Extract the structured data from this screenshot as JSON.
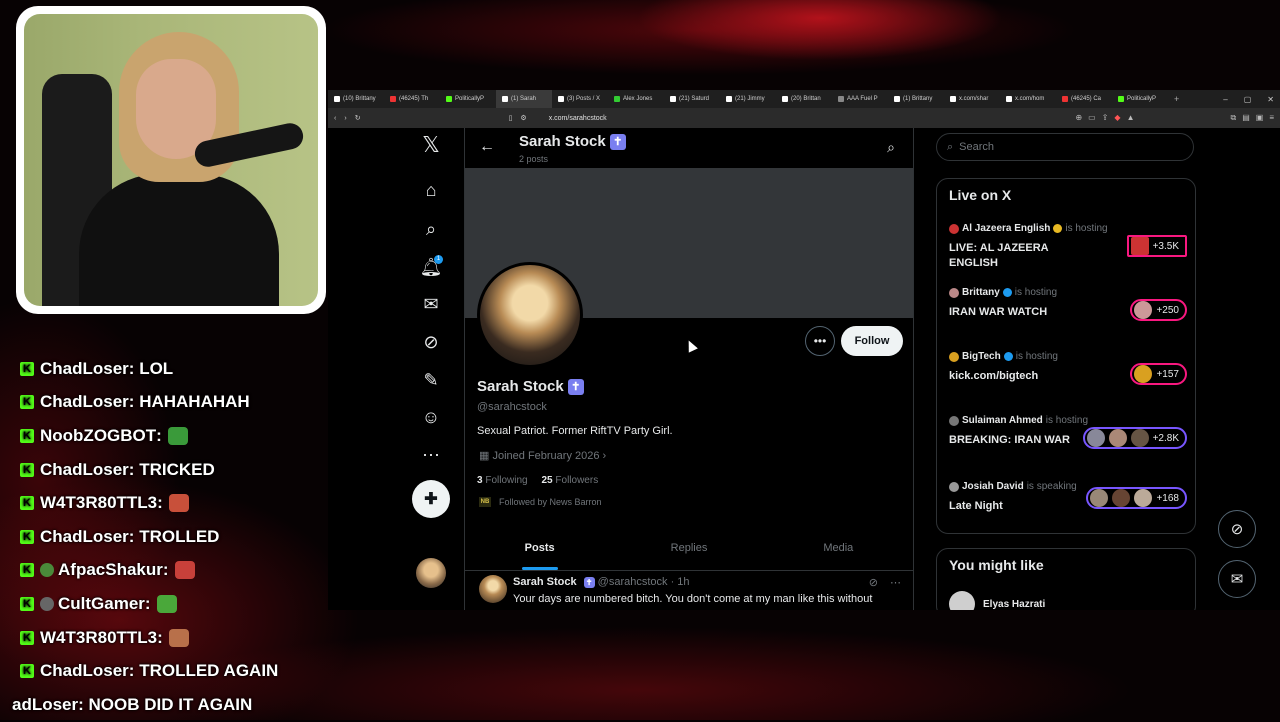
{
  "chat": [
    {
      "user": "ChadLoser",
      "text": "LOL"
    },
    {
      "user": "ChadLoser",
      "text": "HAHAHAHAH"
    },
    {
      "user": "NoobZOGBOT",
      "text": ""
    },
    {
      "user": "ChadLoser",
      "text": "TRICKED"
    },
    {
      "user": "W4T3R80TTL3",
      "text": ""
    },
    {
      "user": "ChadLoser",
      "text": "TROLLED"
    },
    {
      "user": "AfpacShakur",
      "text": ""
    },
    {
      "user": "CultGamer",
      "text": ""
    },
    {
      "user": "W4T3R80TTL3",
      "text": ""
    },
    {
      "user": "ChadLoser",
      "text": "TROLLED AGAIN"
    },
    {
      "user": "adLoser",
      "text": "NOOB DID IT AGAIN"
    }
  ],
  "browser": {
    "tabs": [
      "(10) Brittany",
      "(46245) Th",
      "PoliticallyP",
      "(1) Sarah",
      "(3) Posts / X",
      "Alex Jones",
      "(21) Saturd",
      "(21) Jimmy",
      "(20) Brittan",
      "AAA Fuel P",
      "(1) Brittany",
      "x.com/shar",
      "x.com/hom",
      "(46245) Ca",
      "PoliticallyP"
    ],
    "url": "x.com/sarahcstock"
  },
  "header": {
    "name": "Sarah Stock",
    "posts": "2 posts"
  },
  "profile": {
    "name": "Sarah Stock",
    "handle": "@sarahcstock",
    "bio": "Sexual Patriot. Former RiftTV Party Girl.",
    "joined": "Joined February 2026",
    "following_count": "3",
    "following_label": "Following",
    "followers_count": "25",
    "followers_label": "Followers",
    "followed_by": "Followed by News Barron",
    "nb": "NB",
    "follow_label": "Follow"
  },
  "tabs": {
    "posts": "Posts",
    "replies": "Replies",
    "media": "Media"
  },
  "tweet": {
    "name": "Sarah Stock",
    "meta": "@sarahcstock · 1h",
    "text": "Your days are numbered bitch. You don't come at my man like this without"
  },
  "search": {
    "placeholder": "Search"
  },
  "live": {
    "title": "Live on X",
    "items": [
      {
        "host": "Al Jazeera English",
        "status": "is hosting",
        "title": "LIVE: AL JAZEERA ENGLISH",
        "count": "+3.5K",
        "pill_color": "#f91880"
      },
      {
        "host": "Brittany",
        "status": "is hosting",
        "title": "IRAN WAR WATCH",
        "count": "+250",
        "pill_color": "#f91880"
      },
      {
        "host": "BigTech",
        "status": "is hosting",
        "title": "kick.com/bigtech",
        "count": "+157",
        "pill_color": "#f91880"
      },
      {
        "host": "Sulaiman Ahmed",
        "status": "is hosting",
        "title": "BREAKING: IRAN WAR",
        "count": "+2.8K",
        "pill_color": "#7856ff"
      },
      {
        "host": "Josiah David",
        "status": "is speaking",
        "title": "Late Night",
        "count": "+168",
        "pill_color": "#7856ff"
      }
    ]
  },
  "might_like": {
    "title": "You might like",
    "first": "Elyas Hazrati"
  },
  "colors": {
    "x_blue": "#1d9bf0",
    "kick_green": "#53fc18",
    "space_pink": "#f91880",
    "space_purple": "#7856ff"
  }
}
